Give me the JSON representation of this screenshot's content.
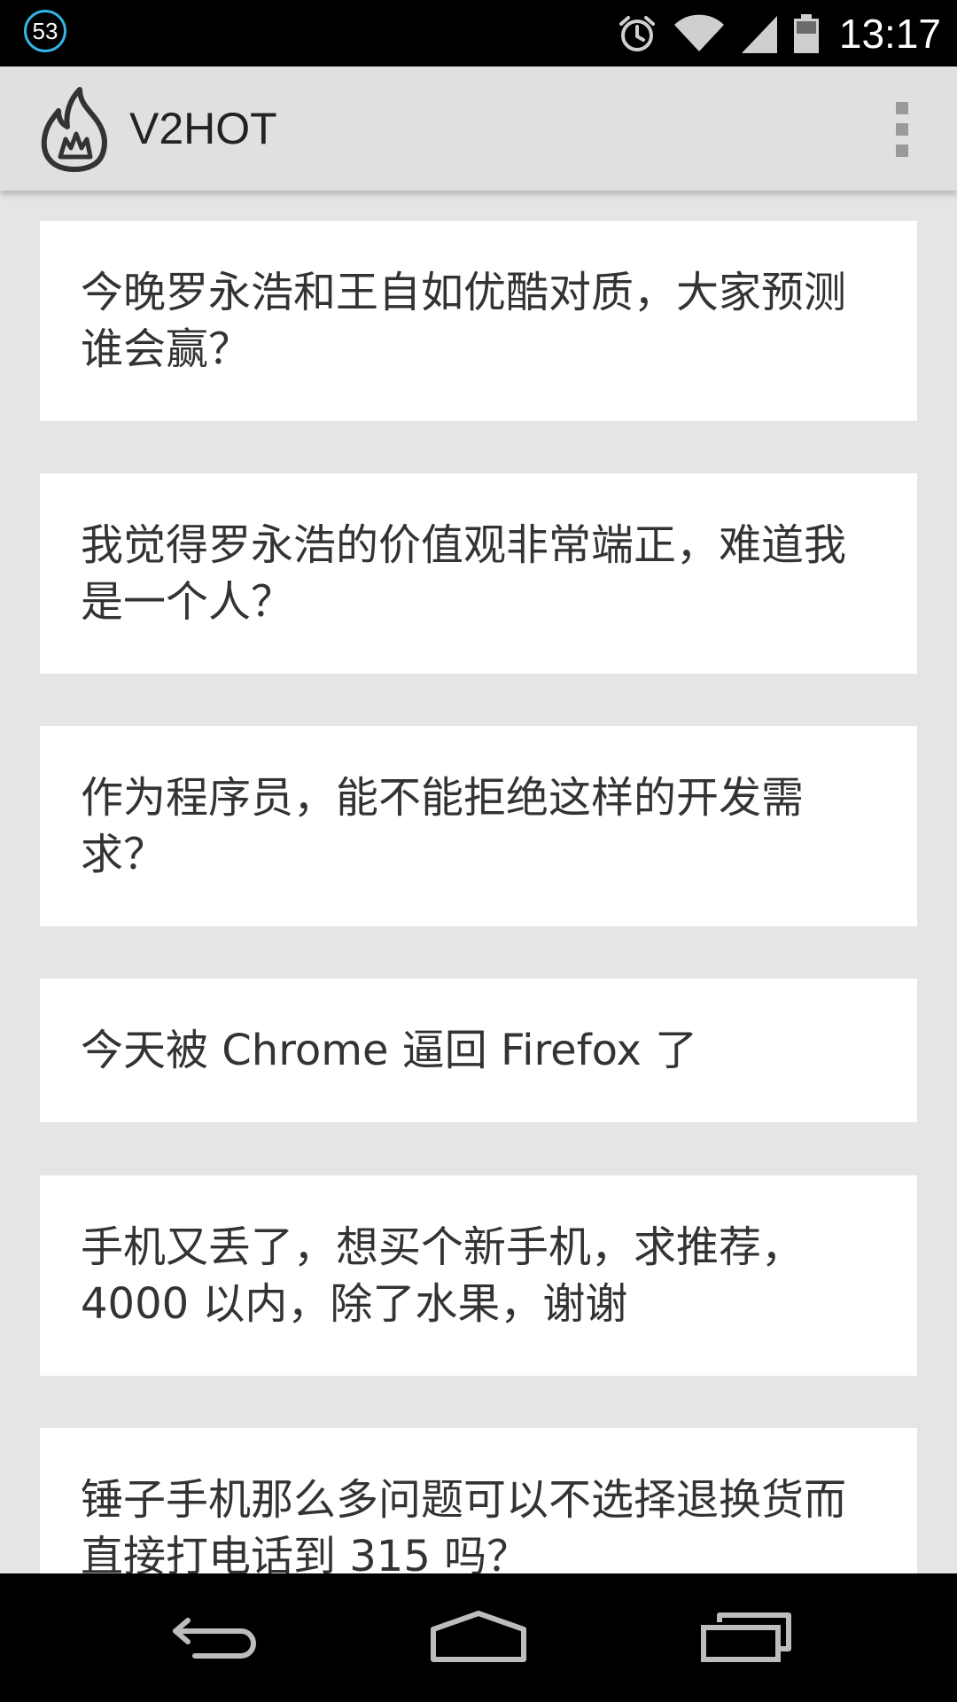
{
  "status_bar": {
    "notification_count": "53",
    "time": "13:17",
    "icons": [
      "alarm-icon",
      "wifi-icon",
      "signal-icon",
      "battery-icon"
    ]
  },
  "action_bar": {
    "title": "V2HOT",
    "logo_icon": "flame-icon",
    "menu_icon": "overflow-menu-icon"
  },
  "topics": [
    {
      "title": "今晚罗永浩和王自如优酷对质，大家预测谁会赢？"
    },
    {
      "title": "我觉得罗永浩的价值观非常端正，难道我是一个人？"
    },
    {
      "title": "作为程序员，能不能拒绝这样的开发需求？"
    },
    {
      "title": "今天被 Chrome 逼回 Firefox 了"
    },
    {
      "title": "手机又丢了，想买个新手机，求推荐，4000 以内，除了水果，谢谢"
    },
    {
      "title": "锤子手机那么多问题可以不选择退换货而直接打电话到 315 吗？"
    }
  ],
  "nav_bar": {
    "buttons": [
      "back-icon",
      "home-icon",
      "recent-apps-icon"
    ]
  }
}
